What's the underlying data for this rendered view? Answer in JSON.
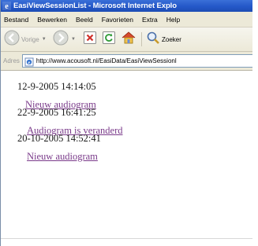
{
  "window": {
    "title": "EasiViewSessionList - Microsoft Internet Explo"
  },
  "menu": {
    "items": [
      "Bestand",
      "Bewerken",
      "Beeld",
      "Favorieten",
      "Extra",
      "Help"
    ]
  },
  "toolbar": {
    "back_label": "Vorige",
    "search_label": "Zoeker"
  },
  "address": {
    "label": "Adres",
    "url": "http://www.acousoft.nl/EasiData/EasiViewSessionl"
  },
  "sessions": [
    {
      "timestamp": "12-9-2005 14:14:05",
      "link": "Nieuw audiogram"
    },
    {
      "timestamp": "22-9-2005 16:41:25",
      "link": "Audiogram is veranderd"
    },
    {
      "timestamp": "20-10-2005 14:52:41",
      "link": "Nieuw audiogram"
    }
  ],
  "colors": {
    "titlebar": "#2458c8",
    "chrome": "#ece9d8",
    "visited_link": "#7a3a8a"
  }
}
